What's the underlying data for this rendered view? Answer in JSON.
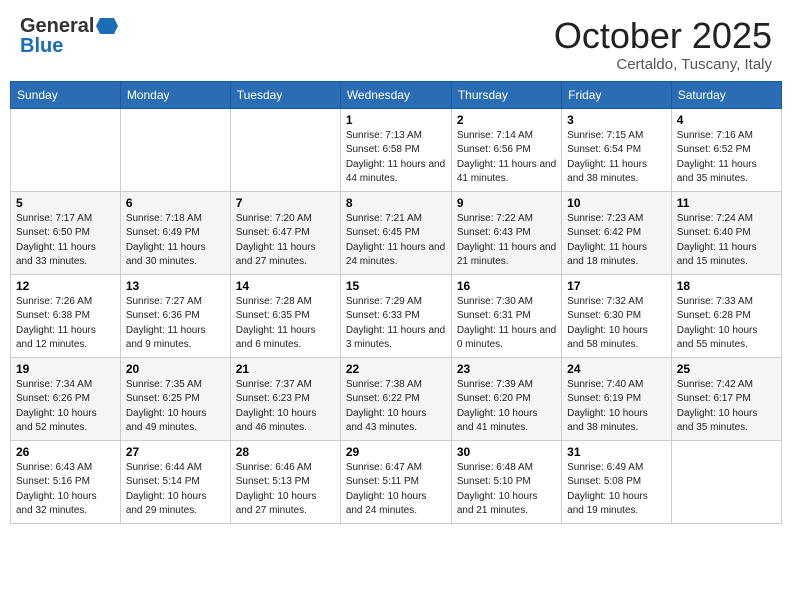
{
  "header": {
    "logo_general": "General",
    "logo_blue": "Blue",
    "month_title": "October 2025",
    "location": "Certaldo, Tuscany, Italy"
  },
  "days_of_week": [
    "Sunday",
    "Monday",
    "Tuesday",
    "Wednesday",
    "Thursday",
    "Friday",
    "Saturday"
  ],
  "weeks": [
    [
      {
        "day": "",
        "info": ""
      },
      {
        "day": "",
        "info": ""
      },
      {
        "day": "",
        "info": ""
      },
      {
        "day": "1",
        "info": "Sunrise: 7:13 AM\nSunset: 6:58 PM\nDaylight: 11 hours and 44 minutes."
      },
      {
        "day": "2",
        "info": "Sunrise: 7:14 AM\nSunset: 6:56 PM\nDaylight: 11 hours and 41 minutes."
      },
      {
        "day": "3",
        "info": "Sunrise: 7:15 AM\nSunset: 6:54 PM\nDaylight: 11 hours and 38 minutes."
      },
      {
        "day": "4",
        "info": "Sunrise: 7:16 AM\nSunset: 6:52 PM\nDaylight: 11 hours and 35 minutes."
      }
    ],
    [
      {
        "day": "5",
        "info": "Sunrise: 7:17 AM\nSunset: 6:50 PM\nDaylight: 11 hours and 33 minutes."
      },
      {
        "day": "6",
        "info": "Sunrise: 7:18 AM\nSunset: 6:49 PM\nDaylight: 11 hours and 30 minutes."
      },
      {
        "day": "7",
        "info": "Sunrise: 7:20 AM\nSunset: 6:47 PM\nDaylight: 11 hours and 27 minutes."
      },
      {
        "day": "8",
        "info": "Sunrise: 7:21 AM\nSunset: 6:45 PM\nDaylight: 11 hours and 24 minutes."
      },
      {
        "day": "9",
        "info": "Sunrise: 7:22 AM\nSunset: 6:43 PM\nDaylight: 11 hours and 21 minutes."
      },
      {
        "day": "10",
        "info": "Sunrise: 7:23 AM\nSunset: 6:42 PM\nDaylight: 11 hours and 18 minutes."
      },
      {
        "day": "11",
        "info": "Sunrise: 7:24 AM\nSunset: 6:40 PM\nDaylight: 11 hours and 15 minutes."
      }
    ],
    [
      {
        "day": "12",
        "info": "Sunrise: 7:26 AM\nSunset: 6:38 PM\nDaylight: 11 hours and 12 minutes."
      },
      {
        "day": "13",
        "info": "Sunrise: 7:27 AM\nSunset: 6:36 PM\nDaylight: 11 hours and 9 minutes."
      },
      {
        "day": "14",
        "info": "Sunrise: 7:28 AM\nSunset: 6:35 PM\nDaylight: 11 hours and 6 minutes."
      },
      {
        "day": "15",
        "info": "Sunrise: 7:29 AM\nSunset: 6:33 PM\nDaylight: 11 hours and 3 minutes."
      },
      {
        "day": "16",
        "info": "Sunrise: 7:30 AM\nSunset: 6:31 PM\nDaylight: 11 hours and 0 minutes."
      },
      {
        "day": "17",
        "info": "Sunrise: 7:32 AM\nSunset: 6:30 PM\nDaylight: 10 hours and 58 minutes."
      },
      {
        "day": "18",
        "info": "Sunrise: 7:33 AM\nSunset: 6:28 PM\nDaylight: 10 hours and 55 minutes."
      }
    ],
    [
      {
        "day": "19",
        "info": "Sunrise: 7:34 AM\nSunset: 6:26 PM\nDaylight: 10 hours and 52 minutes."
      },
      {
        "day": "20",
        "info": "Sunrise: 7:35 AM\nSunset: 6:25 PM\nDaylight: 10 hours and 49 minutes."
      },
      {
        "day": "21",
        "info": "Sunrise: 7:37 AM\nSunset: 6:23 PM\nDaylight: 10 hours and 46 minutes."
      },
      {
        "day": "22",
        "info": "Sunrise: 7:38 AM\nSunset: 6:22 PM\nDaylight: 10 hours and 43 minutes."
      },
      {
        "day": "23",
        "info": "Sunrise: 7:39 AM\nSunset: 6:20 PM\nDaylight: 10 hours and 41 minutes."
      },
      {
        "day": "24",
        "info": "Sunrise: 7:40 AM\nSunset: 6:19 PM\nDaylight: 10 hours and 38 minutes."
      },
      {
        "day": "25",
        "info": "Sunrise: 7:42 AM\nSunset: 6:17 PM\nDaylight: 10 hours and 35 minutes."
      }
    ],
    [
      {
        "day": "26",
        "info": "Sunrise: 6:43 AM\nSunset: 5:16 PM\nDaylight: 10 hours and 32 minutes."
      },
      {
        "day": "27",
        "info": "Sunrise: 6:44 AM\nSunset: 5:14 PM\nDaylight: 10 hours and 29 minutes."
      },
      {
        "day": "28",
        "info": "Sunrise: 6:46 AM\nSunset: 5:13 PM\nDaylight: 10 hours and 27 minutes."
      },
      {
        "day": "29",
        "info": "Sunrise: 6:47 AM\nSunset: 5:11 PM\nDaylight: 10 hours and 24 minutes."
      },
      {
        "day": "30",
        "info": "Sunrise: 6:48 AM\nSunset: 5:10 PM\nDaylight: 10 hours and 21 minutes."
      },
      {
        "day": "31",
        "info": "Sunrise: 6:49 AM\nSunset: 5:08 PM\nDaylight: 10 hours and 19 minutes."
      },
      {
        "day": "",
        "info": ""
      }
    ]
  ]
}
